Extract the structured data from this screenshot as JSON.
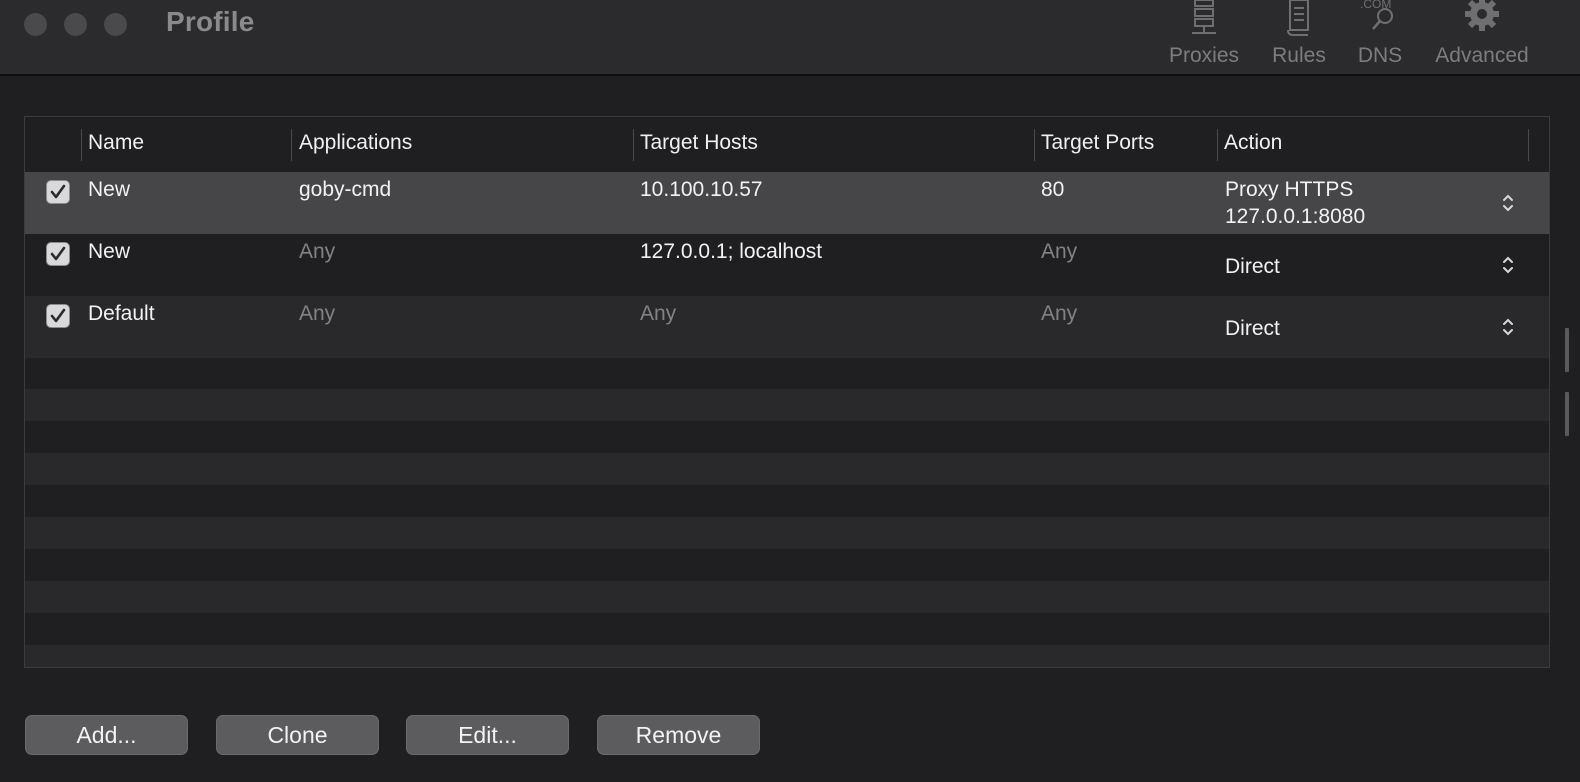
{
  "window": {
    "title": "Profile"
  },
  "toolbar": {
    "items": [
      {
        "label": "Proxies",
        "icon": "server-icon"
      },
      {
        "label": "Rules",
        "icon": "scroll-icon"
      },
      {
        "label": "DNS",
        "icon": "dns-search-icon",
        "icon_text": ".COM"
      },
      {
        "label": "Advanced",
        "icon": "gear-icon"
      }
    ]
  },
  "table": {
    "columns": [
      "Name",
      "Applications",
      "Target Hosts",
      "Target Ports",
      "Action"
    ],
    "rows": [
      {
        "checked": true,
        "name": "New",
        "applications": "goby-cmd",
        "hosts": "10.100.10.57",
        "ports": "80",
        "action_line1": "Proxy HTTPS",
        "action_line2": "127.0.0.1:8080"
      },
      {
        "checked": true,
        "name": "New",
        "applications": "Any",
        "hosts": "127.0.0.1; localhost",
        "ports": "Any",
        "action_line1": "Direct",
        "action_line2": ""
      },
      {
        "checked": true,
        "name": "Default",
        "applications": "Any",
        "hosts": "Any",
        "ports": "Any",
        "action_line1": "Direct",
        "action_line2": ""
      }
    ],
    "selected_row": 0
  },
  "buttons": {
    "add": "Add...",
    "clone": "Clone",
    "edit": "Edit...",
    "remove": "Remove"
  },
  "colors": {
    "background": "#1f1f21",
    "selected_row": "#464648",
    "stripe": "#29292b",
    "button": "#5c5c5e"
  }
}
